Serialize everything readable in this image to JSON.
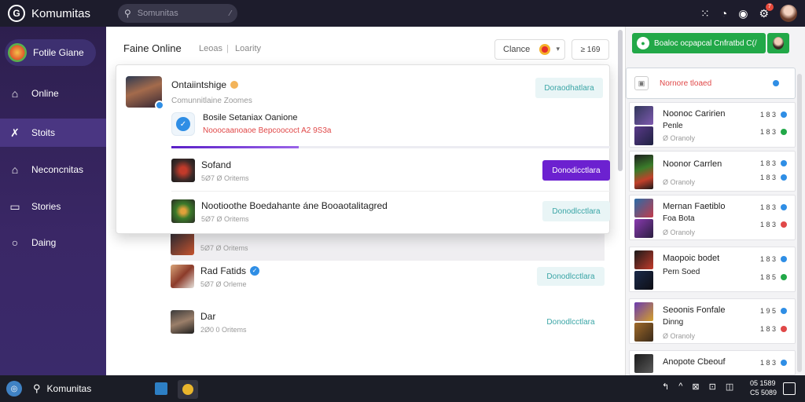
{
  "topbar": {
    "brand": "Komumitas",
    "search_placeholder": "Somunitas",
    "badge_count": "7"
  },
  "sidebar": {
    "game": "Fotile Giane",
    "items": [
      {
        "label": "Online",
        "icon": "home-icon"
      },
      {
        "label": "Stoits",
        "icon": "run-icon"
      },
      {
        "label": "Neconcnitas",
        "icon": "house-icon"
      },
      {
        "label": "Stories",
        "icon": "chart-icon"
      },
      {
        "label": "Daing",
        "icon": "circle-icon"
      }
    ]
  },
  "main": {
    "title": "Faine Online",
    "tabs": [
      "Leoas",
      "Loarity"
    ],
    "filter_label": "Clance",
    "count_label": "≥ 169",
    "rows": [
      {
        "title": "",
        "sub": "5Ø7 Ø Oritems",
        "button": ""
      },
      {
        "title": "Rad Fatids",
        "sub": "5Ø7 Ø Orleme",
        "button": "Donodlcctlara",
        "verified": true
      },
      {
        "title": "Dar",
        "sub": "2Ø0 0 Oritems",
        "button": "Donodlcctlara"
      }
    ]
  },
  "popup": {
    "name": "Ontaiintshige",
    "sub": "Comunnitlaine Zoomes",
    "follow_label": "Doraodhatlara",
    "notice_title": "Bosile Setaniax Oanione",
    "notice_sub": "Nooocaanoaoe Bepcoococt A2 9S3a",
    "progress": 0.29,
    "rows": [
      {
        "title": "Sofand",
        "sub": "5Ø7 Ø Oritems",
        "button": "Donodicctlara"
      },
      {
        "title": "Nootioothe Boedahante áne Booaotalitagred",
        "sub": "5Ø7 Ø Oritems",
        "button": "Donodlcctlara"
      }
    ]
  },
  "rpanel": {
    "top_text": "Boaloc ocpapcal Cnfratbd C(/",
    "selected": "Nornore tloaed",
    "cards": [
      {
        "title": "Noonoc Caririen",
        "line2": "Penle",
        "sub": "Ø Oranoly",
        "num1": "1 8 3",
        "num2": "1 8 3"
      },
      {
        "title": "Noonor Carrlen",
        "line2": "",
        "sub": "Ø Oranoly",
        "num1": "1 8 3",
        "num2": "1 8 3"
      },
      {
        "title": "Mernan Faetiblo",
        "line2": "Foa Bota",
        "sub": "Ø Oranoly",
        "num1": "1 8 3",
        "num2": "1 8 3"
      },
      {
        "title": "Maopoic bodet",
        "line2": "Pern Soed",
        "sub": "",
        "num1": "1 8 3",
        "num2": "1 8 5"
      },
      {
        "title": "Seoonis Fonfale",
        "line2": "Dinng",
        "sub": "Ø Oranoly",
        "num1": "1 9 5",
        "num2": "1 8 3"
      },
      {
        "title": "Anopote Cbeouf",
        "line2": "",
        "sub": "",
        "num1": "1 8 3",
        "num2": ""
      }
    ]
  },
  "taskbar": {
    "search_text": "Komunitas",
    "time": "05 1589",
    "date": "C5 5089"
  },
  "colors": {
    "accent": "#6c21d0",
    "sidebar": "#2d1f4e",
    "online_green": "#22a848",
    "button_teal": "#3aa5a6"
  }
}
